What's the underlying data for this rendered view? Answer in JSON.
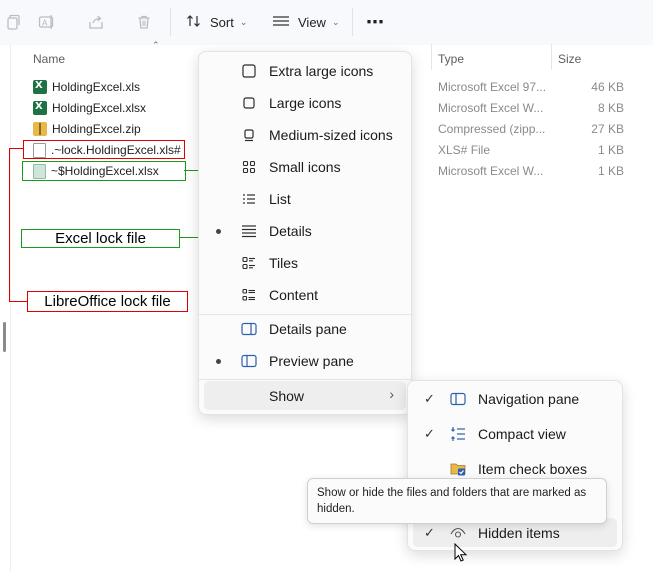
{
  "toolbar": {
    "sort_label": "Sort",
    "view_label": "View",
    "more_label": "⋯",
    "icons": [
      "copy-icon",
      "rename-icon",
      "share-icon",
      "delete-icon",
      "sort-icon",
      "view-icon",
      "more-icon"
    ]
  },
  "columns": {
    "name": "Name",
    "type": "Type",
    "size": "Size"
  },
  "files": [
    {
      "name": "HoldingExcel.xls",
      "type": "Microsoft Excel 97...",
      "size": "46 KB",
      "icon": "excel-file-icon"
    },
    {
      "name": "HoldingExcel.xlsx",
      "type": "Microsoft Excel W...",
      "size": "8 KB",
      "icon": "excel-file-icon"
    },
    {
      "name": "HoldingExcel.zip",
      "type": "Compressed (zipp...",
      "size": "27 KB",
      "icon": "zip-folder-icon"
    },
    {
      "name": ".~lock.HoldingExcel.xls#",
      "type": "XLS# File",
      "size": "1 KB",
      "icon": "blank-file-icon"
    },
    {
      "name": "~$HoldingExcel.xlsx",
      "type": "Microsoft Excel W...",
      "size": "1 KB",
      "icon": "excel-file-icon"
    }
  ],
  "annotations": {
    "excel_lock": "Excel lock file",
    "libre_lock": "LibreOffice lock file",
    "colors": {
      "red": "#e00000",
      "green": "#1a9a1a"
    }
  },
  "view_menu": {
    "items": [
      {
        "label": "Extra large icons",
        "icon": "extra-large-icons-icon"
      },
      {
        "label": "Large icons",
        "icon": "large-icons-icon"
      },
      {
        "label": "Medium-sized icons",
        "icon": "medium-icons-icon"
      },
      {
        "label": "Small icons",
        "icon": "small-icons-icon"
      },
      {
        "label": "List",
        "icon": "list-icon"
      },
      {
        "label": "Details",
        "icon": "details-icon",
        "selected": true
      },
      {
        "label": "Tiles",
        "icon": "tiles-icon"
      },
      {
        "label": "Content",
        "icon": "content-icon"
      }
    ],
    "panes": [
      {
        "label": "Details pane",
        "icon": "details-pane-icon"
      },
      {
        "label": "Preview pane",
        "icon": "preview-pane-icon",
        "selected": true
      }
    ],
    "show_label": "Show"
  },
  "show_submenu": {
    "items": [
      {
        "label": "Navigation pane",
        "checked": true,
        "icon": "navigation-pane-icon"
      },
      {
        "label": "Compact view",
        "checked": true,
        "icon": "compact-view-icon"
      },
      {
        "label": "Item check boxes",
        "checked": false,
        "icon": "item-check-boxes-icon"
      },
      {
        "label": "Hidden items",
        "checked": true,
        "icon": "hidden-items-icon"
      }
    ]
  },
  "tooltip": {
    "text": "Show or hide the files and folders that are marked as hidden."
  }
}
